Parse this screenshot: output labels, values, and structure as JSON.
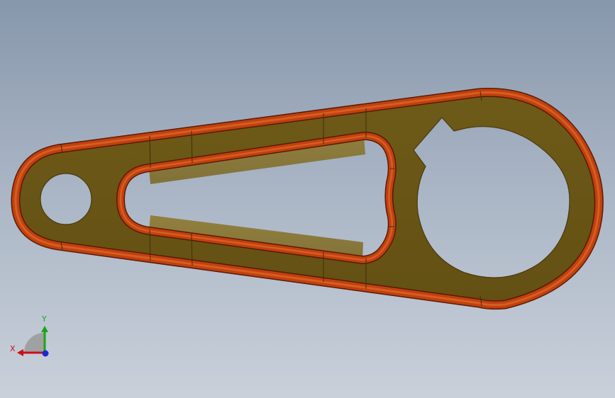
{
  "viewport": {
    "background_top": "#8797ab",
    "background_bottom": "#c9d0da"
  },
  "part": {
    "face_color": "#6b5617",
    "face_highlight_color": "#8a7425",
    "edge_fillet_color": "#c0410e",
    "edge_fillet_highlight": "#e06a2c",
    "edge_outline_color": "#5a1a05"
  },
  "triad": {
    "x_label": "X",
    "y_label": "Y",
    "x_color": "#c8101a",
    "y_color": "#1aa51a",
    "z_color": "#1a2ad0"
  }
}
